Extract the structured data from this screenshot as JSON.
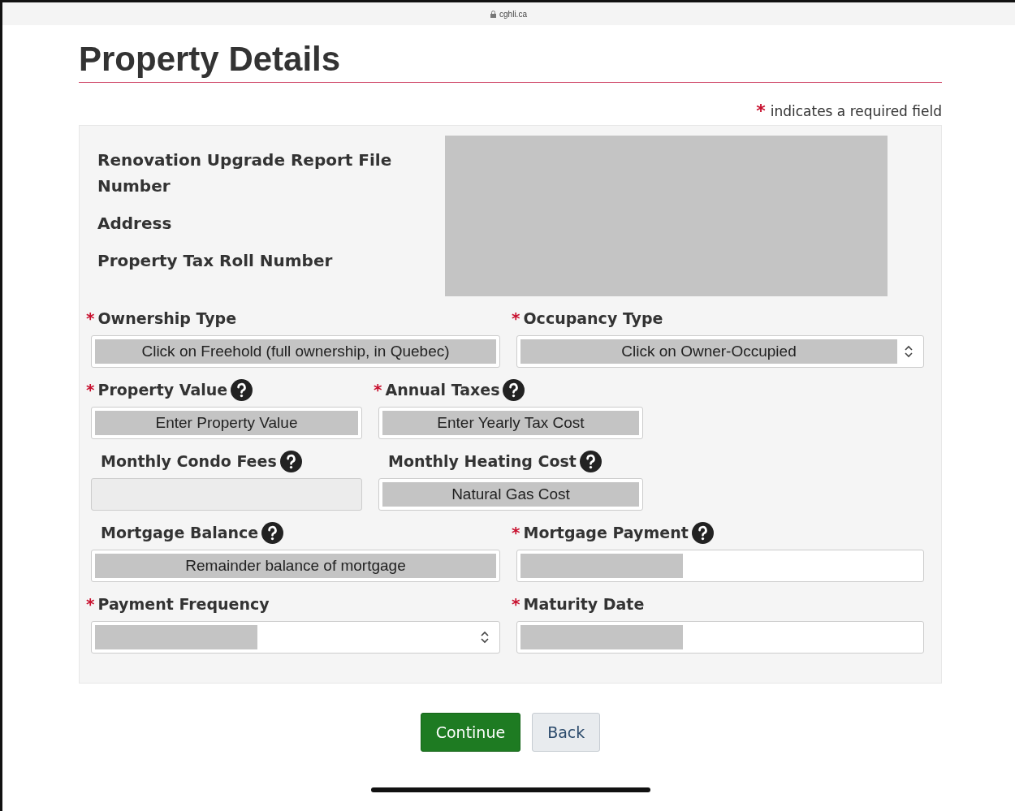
{
  "browser": {
    "url": "cghli.ca"
  },
  "page": {
    "title": "Property Details",
    "required_note": "indicates a required field",
    "required_mark": "*"
  },
  "info": {
    "labels": [
      "Renovation Upgrade Report File Number",
      "Address",
      "Property Tax Roll Number"
    ],
    "redacted": true
  },
  "rows": [
    {
      "kind": "wide",
      "fields": [
        {
          "label": "Ownership Type",
          "required": true,
          "help": false,
          "kind": "input",
          "value": "Click on Freehold (full ownership, in Quebec)",
          "redacted": false,
          "disabled": false
        },
        {
          "label": "Occupancy Type",
          "required": true,
          "help": false,
          "kind": "select",
          "value": "Click on Owner-Occupied",
          "redacted": false,
          "disabled": false
        }
      ]
    },
    {
      "kind": "narrow",
      "fields": [
        {
          "label": "Property Value",
          "required": true,
          "help": true,
          "kind": "input",
          "value": "Enter Property Value",
          "redacted": false,
          "disabled": false
        },
        {
          "label": "Annual Taxes",
          "required": true,
          "help": true,
          "kind": "input",
          "value": "Enter Yearly Tax Cost",
          "redacted": false,
          "disabled": false
        }
      ]
    },
    {
      "kind": "narrow",
      "fields": [
        {
          "label": "Monthly Condo Fees",
          "required": false,
          "help": true,
          "kind": "input",
          "redacted": false,
          "disabled": true
        },
        {
          "label": "Monthly Heating Cost",
          "required": false,
          "help": true,
          "kind": "input",
          "value": "Natural Gas Cost",
          "redacted": false,
          "disabled": false
        }
      ]
    },
    {
      "kind": "wide",
      "fields": [
        {
          "label": "Mortgage Balance",
          "required": false,
          "help": true,
          "kind": "input",
          "value": "Remainder balance of mortgage",
          "redacted": false,
          "disabled": false
        },
        {
          "label": "Mortgage Payment",
          "required": true,
          "help": true,
          "kind": "input",
          "redacted": true,
          "disabled": false
        }
      ]
    },
    {
      "kind": "wide",
      "fields": [
        {
          "label": "Payment Frequency",
          "required": true,
          "help": false,
          "kind": "select",
          "redacted": true,
          "disabled": false
        },
        {
          "label": "Maturity Date",
          "required": true,
          "help": false,
          "kind": "input",
          "redacted": true,
          "disabled": false
        }
      ]
    }
  ],
  "buttons": [
    {
      "label": "Continue",
      "kind": "primary"
    },
    {
      "label": "Back",
      "kind": "secondary"
    }
  ]
}
